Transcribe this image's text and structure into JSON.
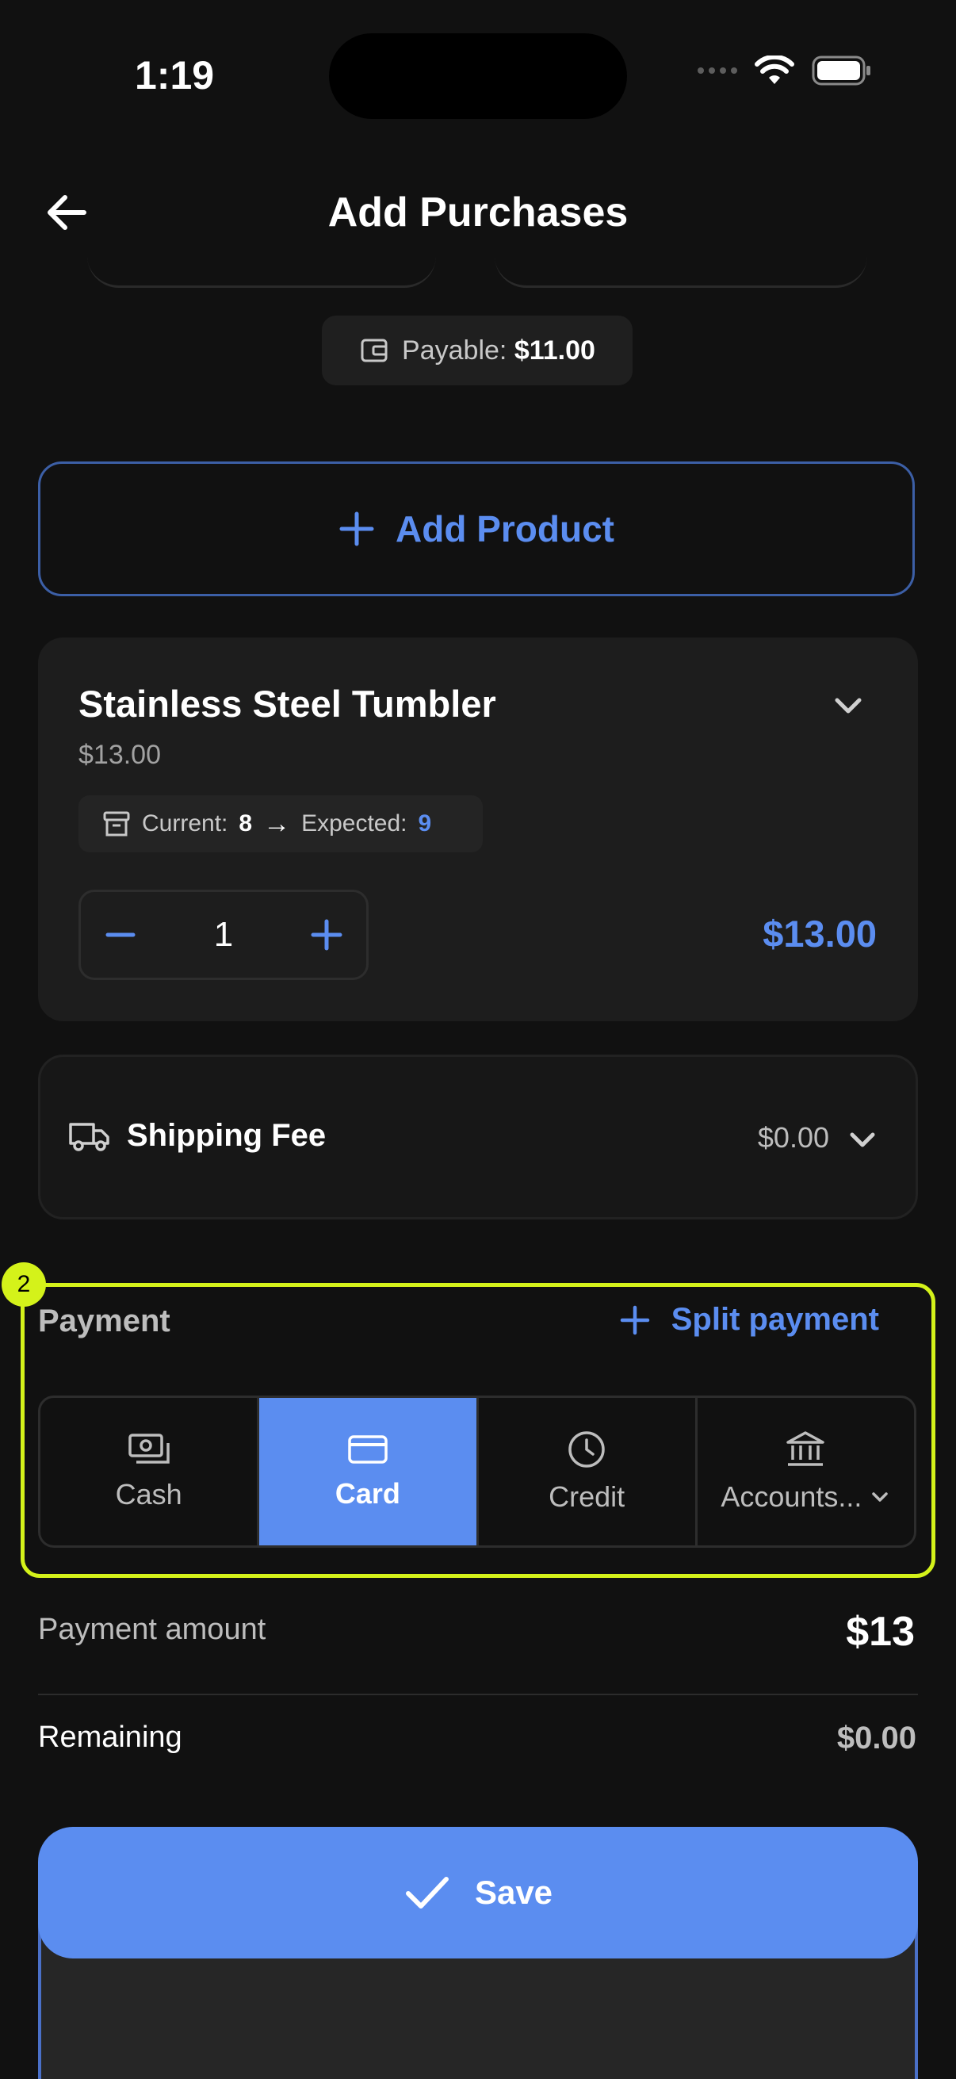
{
  "status_bar": {
    "time": "1:19"
  },
  "header": {
    "title": "Add Purchases"
  },
  "payable": {
    "label": "Payable:",
    "amount": "$11.00"
  },
  "add_product": {
    "label": "Add Product"
  },
  "product": {
    "name": "Stainless Steel Tumbler",
    "price": "$13.00",
    "current_label": "Current:",
    "current_value": "8",
    "arrow": "→",
    "expected_label": "Expected:",
    "expected_value": "9",
    "quantity": "1",
    "line_total": "$13.00"
  },
  "shipping": {
    "label": "Shipping Fee",
    "value": "$0.00"
  },
  "annotation": {
    "badge": "2"
  },
  "payment": {
    "title": "Payment",
    "split_label": "Split payment",
    "methods": [
      {
        "label": "Cash",
        "icon": "cash-icon"
      },
      {
        "label": "Card",
        "icon": "card-icon",
        "selected": true
      },
      {
        "label": "Credit",
        "icon": "clock-icon"
      },
      {
        "label": "Accounts...",
        "icon": "bank-icon"
      }
    ],
    "amount_label": "Payment amount",
    "amount_value": "$13",
    "remaining_label": "Remaining",
    "remaining_value": "$0.00"
  },
  "save": {
    "label": "Save"
  },
  "colors": {
    "accent": "#5b8df0",
    "highlight": "#d4f21a",
    "background": "#111111"
  }
}
